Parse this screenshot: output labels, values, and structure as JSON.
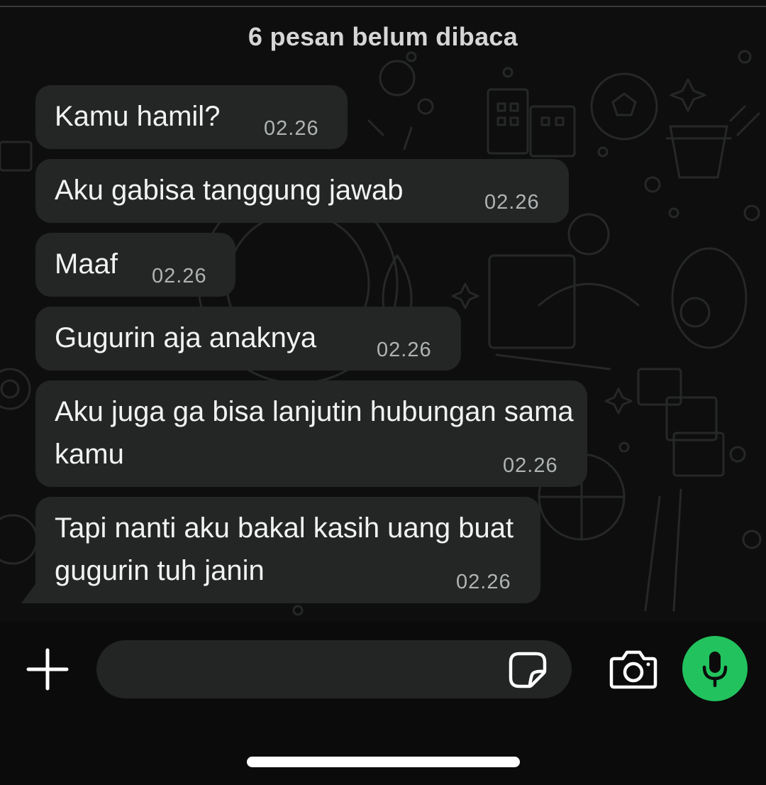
{
  "chat": {
    "unread_banner": "6 pesan belum dibaca",
    "messages": [
      {
        "text": "Kamu hamil?",
        "time": "02.26"
      },
      {
        "text": "Aku gabisa tanggung jawab",
        "time": "02.26"
      },
      {
        "text": "Maaf",
        "time": "02.26"
      },
      {
        "text": "Gugurin aja anaknya",
        "time": "02.26"
      },
      {
        "text": "Aku juga ga bisa lanjutin hubungan sama kamu",
        "time": "02.26"
      },
      {
        "text": "Tapi nanti aku bakal kasih uang buat gugurin tuh janin",
        "time": "02.26"
      }
    ]
  },
  "input_bar": {
    "plus_icon": "plus-icon",
    "sticker_icon": "sticker-icon",
    "camera_icon": "camera-icon",
    "mic_icon": "microphone-icon"
  },
  "colors": {
    "bubble": "#242626",
    "mic_button": "#22c35e",
    "background": "#0b0b0b"
  }
}
